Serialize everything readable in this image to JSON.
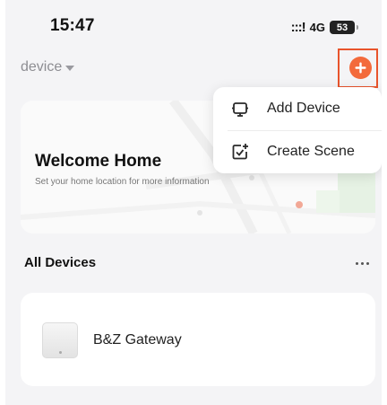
{
  "status_bar": {
    "time": "15:47",
    "signal": ":::!",
    "network": "4G",
    "battery": "53"
  },
  "header": {
    "home_name": "device",
    "add_icon": "plus-circle-icon",
    "accent_color": "#f36a3b",
    "highlight_color": "#e8542c"
  },
  "welcome_card": {
    "title": "Welcome Home",
    "subtitle": "Set your home location for more information"
  },
  "menu": {
    "items": [
      {
        "label": "Add Device",
        "icon": "add-device-icon"
      },
      {
        "label": "Create Scene",
        "icon": "create-scene-icon"
      }
    ]
  },
  "devices": {
    "section_title": "All Devices",
    "more_icon": "more-dots-icon",
    "items": [
      {
        "name": "B&Z Gateway",
        "icon": "gateway-device-icon"
      }
    ]
  }
}
